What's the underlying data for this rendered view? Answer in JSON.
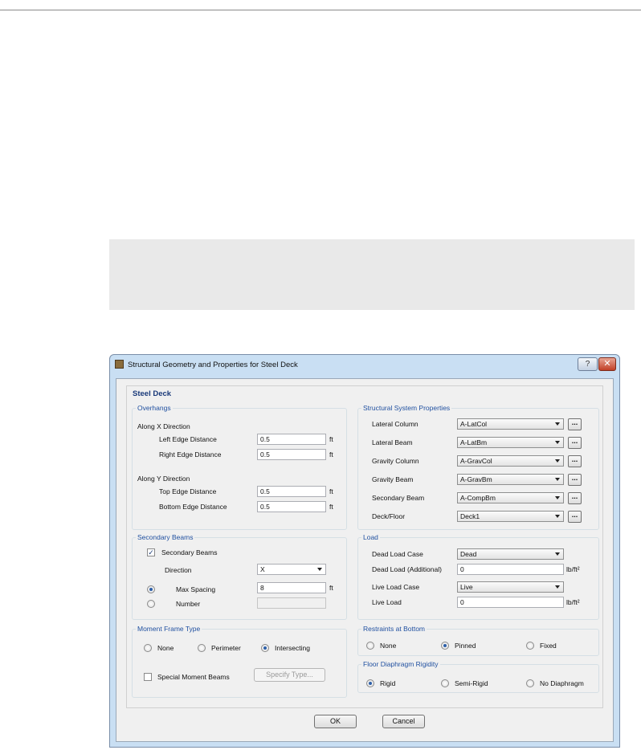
{
  "dialog": {
    "title": "Structural Geometry and Properties for Steel Deck",
    "help_label": "?",
    "close_label": "✕",
    "heading": "Steel Deck"
  },
  "overhangs": {
    "label": "Overhangs",
    "along_x": "Along X Direction",
    "left_edge_label": "Left Edge Distance",
    "left_edge_value": "0.5",
    "right_edge_label": "Right Edge Distance",
    "right_edge_value": "0.5",
    "along_y": "Along Y Direction",
    "top_edge_label": "Top Edge Distance",
    "top_edge_value": "0.5",
    "bottom_edge_label": "Bottom Edge Distance",
    "bottom_edge_value": "0.5",
    "unit": "ft"
  },
  "structural_system": {
    "label": "Structural System Properties",
    "dots": "...",
    "rows": [
      {
        "label": "Lateral Column",
        "value": "A-LatCol"
      },
      {
        "label": "Lateral Beam",
        "value": "A-LatBm"
      },
      {
        "label": "Gravity Column",
        "value": "A-GravCol"
      },
      {
        "label": "Gravity Beam",
        "value": "A-GravBm"
      },
      {
        "label": "Secondary Beam",
        "value": "A-CompBm"
      },
      {
        "label": "Deck/Floor",
        "value": "Deck1"
      }
    ]
  },
  "secondary_beams": {
    "label": "Secondary Beams",
    "checkbox_label": "Secondary Beams",
    "checked": true,
    "direction_label": "Direction",
    "direction_value": "X",
    "max_spacing_label": "Max Spacing",
    "max_spacing_value": "8",
    "unit": "ft",
    "number_label": "Number",
    "number_value": ""
  },
  "load": {
    "label": "Load",
    "dead_case_label": "Dead Load Case",
    "dead_case_value": "Dead",
    "dead_additional_label": "Dead Load (Additional)",
    "dead_additional_value": "0",
    "live_case_label": "Live Load Case",
    "live_case_value": "Live",
    "live_load_label": "Live Load",
    "live_load_value": "0",
    "unit": "lb/ft²"
  },
  "moment_frame": {
    "label": "Moment Frame Type",
    "none": "None",
    "perimeter": "Perimeter",
    "intersecting": "Intersecting",
    "selected": "Intersecting",
    "special_label": "Special Moment Beams",
    "specify_label": "Specify Type..."
  },
  "restraints": {
    "label": "Restraints at Bottom",
    "none": "None",
    "pinned": "Pinned",
    "fixed": "Fixed",
    "selected": "Pinned"
  },
  "diaphragm": {
    "label": "Floor Diaphragm Rigidity",
    "rigid": "Rigid",
    "semi_rigid": "Semi-Rigid",
    "no_diaphragm": "No Diaphragm",
    "selected": "Rigid"
  },
  "buttons": {
    "ok": "OK",
    "cancel": "Cancel"
  },
  "colors": {
    "frame": "#c9dff3",
    "group_label": "#2050a0",
    "heading": "#1a3a7a",
    "close": "#c13f26"
  }
}
